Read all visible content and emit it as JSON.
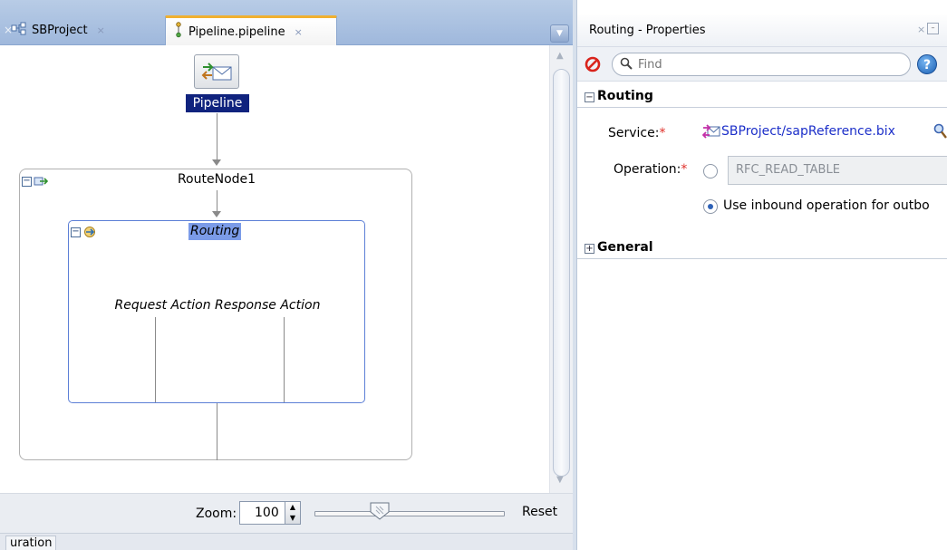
{
  "editor": {
    "tabs": [
      {
        "label": "SBProject",
        "active": false
      },
      {
        "label": "Pipeline.pipeline",
        "active": true
      }
    ],
    "close_glyph": "×",
    "dropdown_glyph": "▼"
  },
  "diagram": {
    "pipeline_label": "Pipeline",
    "route_node_title": "RouteNode1",
    "routing_title": "Routing",
    "request_action": "Request Action",
    "response_action": "Response Action"
  },
  "zoombar": {
    "zoom_label": "Zoom:",
    "zoom_value": "100",
    "zoom_slider_level_percent": 36,
    "reset_label": "Reset"
  },
  "bottom_tab": {
    "label": "uration"
  },
  "properties": {
    "title": "Routing - Properties",
    "search_placeholder": "Find",
    "help_glyph": "?",
    "sections": {
      "routing": {
        "title": "Routing",
        "expanded": true
      },
      "general": {
        "title": "General",
        "expanded": false
      }
    },
    "service_label": "Service:",
    "service_value": "SBProject/sapReference.bix",
    "operation_label": "Operation:",
    "operation_value": "RFC_READ_TABLE",
    "inbound_option_label": "Use inbound operation for outbo",
    "required_marker": "*"
  },
  "colors": {
    "tabbar_bg": "#a9c0e0",
    "pipeline_label_bg": "#10237e",
    "routing_title_bg": "#7b9be8",
    "routing_border": "#5c7fd6",
    "link": "#1c2fc9",
    "required": "#e0302a"
  },
  "icons": {
    "pipeline_node": "envelope-exchange-icon",
    "service": "proxy-service-icon",
    "browse": "magnifier-icon",
    "stop": "stop-icon",
    "help": "help-icon"
  }
}
